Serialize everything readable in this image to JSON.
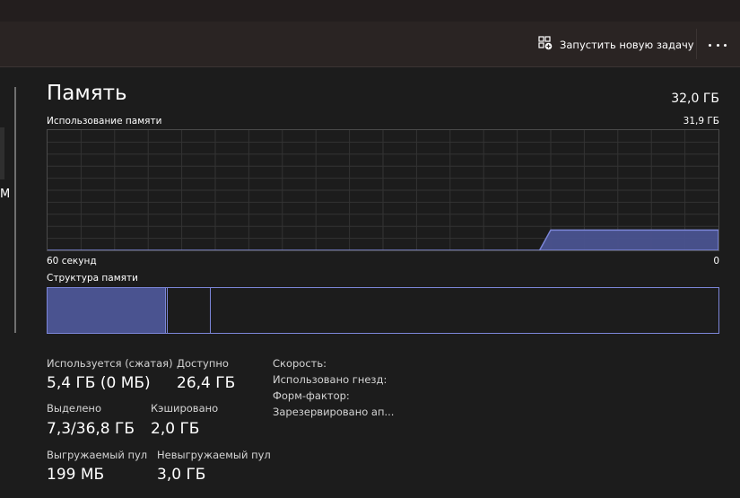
{
  "toolbar": {
    "run_new_task_label": "Запустить новую задачу",
    "run_new_task_icon": "new-task-icon",
    "more_icon": "more-options-icon"
  },
  "sidebar": {
    "partial_label": "М"
  },
  "memory": {
    "title": "Память",
    "total": "32,0 ГБ",
    "usage_label": "Использование памяти",
    "usage_max": "31,9 ГБ",
    "time_span": "60 секунд",
    "time_end": "0",
    "structure_label": "Структура памяти",
    "accent_color": "#7c86d8",
    "fill_color": "#4a5390"
  },
  "chart_data": {
    "type": "area",
    "title": "Использование памяти",
    "xlabel": "",
    "ylabel": "",
    "x_range_label": [
      "60 секунд",
      "0"
    ],
    "ymax_label": "31,9 ГБ",
    "ylim": [
      0,
      31.9
    ],
    "grid": true,
    "x": [
      60,
      16,
      15,
      0
    ],
    "values": [
      0,
      0,
      5.4,
      5.4
    ]
  },
  "structure_data": {
    "total_gb": 32.0,
    "used_gb": 5.6,
    "modified_gb": 0.1,
    "standby_gb": 2.0
  },
  "stats": {
    "in_use_label": "Используется (сжатая)",
    "in_use_value": "5,4 ГБ (0 МБ)",
    "available_label": "Доступно",
    "available_value": "26,4 ГБ",
    "committed_label": "Выделено",
    "committed_value": "7,3/36,8 ГБ",
    "cached_label": "Кэшировано",
    "cached_value": "2,0 ГБ",
    "paged_label": "Выгружаемый пул",
    "paged_value": "199 МБ",
    "nonpaged_label": "Невыгружаемый пул",
    "nonpaged_value": "3,0 ГБ"
  },
  "properties": {
    "speed_label": "Скорость:",
    "slots_label": "Использовано гнезд:",
    "form_factor_label": "Форм-фактор:",
    "reserved_label": "Зарезервировано ап..."
  }
}
